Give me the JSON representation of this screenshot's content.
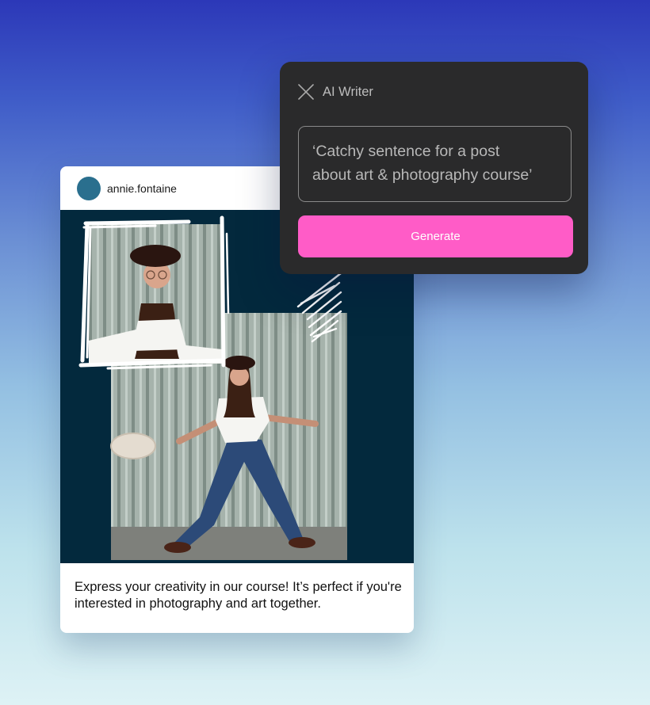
{
  "post": {
    "username": "annie.fontaine",
    "caption": "Express your creativity in our course! It’s perfect if you're interested in photography and art together."
  },
  "ai_writer": {
    "title": "AI Writer",
    "prompt": "‘Catchy sentence for a post\nabout art & photography course’",
    "generate_label": "Generate"
  },
  "colors": {
    "accent": "#ff5cc7",
    "panel_bg": "#2a2a2b",
    "post_bg": "#03293d",
    "avatar": "#2a6f8e"
  },
  "icons": {
    "close": "close-icon"
  }
}
